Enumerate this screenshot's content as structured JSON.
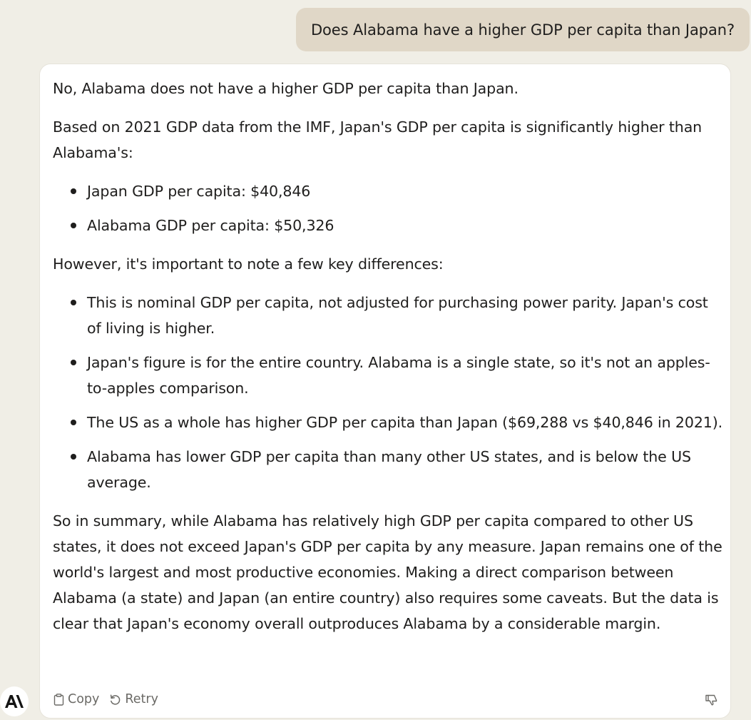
{
  "user_message": "Does Alabama have a higher GDP per capita than Japan?",
  "assistant": {
    "p1": "No, Alabama does not have a higher GDP per capita than Japan.",
    "p2": "Based on 2021 GDP data from the IMF, Japan's GDP per capita is significantly higher than Alabama's:",
    "list1": [
      "Japan GDP per capita: $40,846",
      "Alabama GDP per capita: $50,326"
    ],
    "p3": "However, it's important to note a few key differences:",
    "list2": [
      "This is nominal GDP per capita, not adjusted for purchasing power parity. Japan's cost of living is higher.",
      "Japan's figure is for the entire country. Alabama is a single state, so it's not an apples-to-apples comparison.",
      "The US as a whole has higher GDP per capita than Japan ($69,288 vs $40,846 in 2021).",
      "Alabama has lower GDP per capita than many other US states, and is below the US average."
    ],
    "p4": "So in summary, while Alabama has relatively high GDP per capita compared to other US states, it does not exceed Japan's GDP per capita by any measure. Japan remains one of the world's largest and most productive economies. Making a direct comparison between Alabama (a state) and Japan (an entire country) also requires some caveats. But the data is clear that Japan's economy overall outproduces Alabama by a considerable margin."
  },
  "actions": {
    "copy_label": "Copy",
    "retry_label": "Retry"
  },
  "icons": {
    "logo": "anthropic-logo-icon",
    "copy": "clipboard-icon",
    "retry": "retry-icon",
    "feedback": "thumbs-down-icon"
  }
}
